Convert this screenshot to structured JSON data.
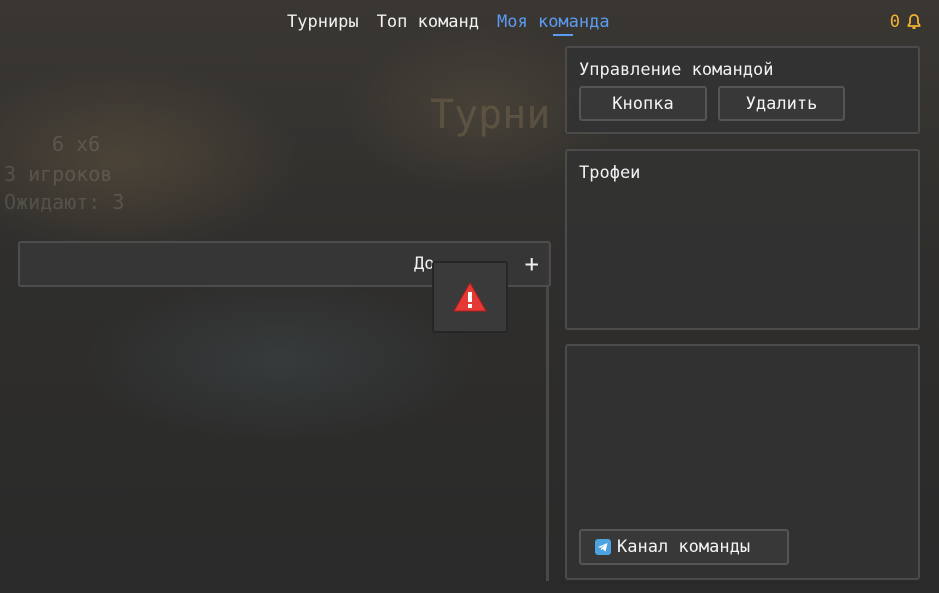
{
  "nav": {
    "tabs": [
      {
        "label": "Турниры",
        "active": false
      },
      {
        "label": "Топ команд",
        "active": false
      },
      {
        "label": "Моя команда",
        "active": true
      }
    ],
    "notifications_count": "0",
    "notification_icon": "bell-icon"
  },
  "background": {
    "title": "Турни",
    "line1": "6 x6",
    "line2": "3 игроков",
    "line3": "Ожидают: 3"
  },
  "manage": {
    "title": "Управление командой",
    "button1_label": "Кнопка",
    "button2_label": "Удалить"
  },
  "trophies": {
    "title": "Трофеи"
  },
  "channel": {
    "button_label": "Канал команды",
    "icon": "telegram-icon"
  },
  "add_bar": {
    "label": "До",
    "plus": "+"
  },
  "warning": {
    "icon": "warning-icon"
  },
  "colors": {
    "accent": "#5b9bf0",
    "notification": "#f2b233",
    "warning": "#e53935",
    "panel_bg": "#323232",
    "panel_border": "#4b4b4b"
  }
}
